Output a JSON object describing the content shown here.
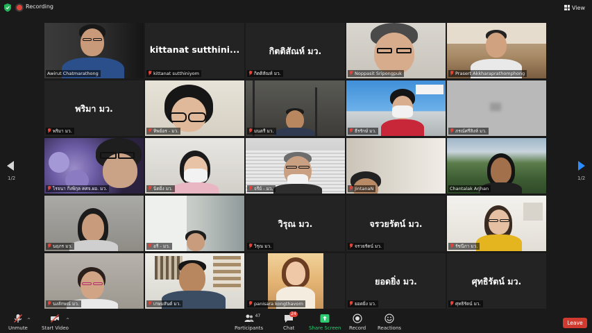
{
  "topbar": {
    "recording_label": "Recording",
    "view_label": "View"
  },
  "nav": {
    "left_page": "1/2",
    "right_page": "1/2"
  },
  "tiles": [
    {
      "name": "Awirut Chatmarathong",
      "big": "",
      "muted": false
    },
    {
      "name": "kittanat sutthiniyom",
      "big": "kittanat  sutthini...",
      "muted": true
    },
    {
      "name": "กิตติสัณห์ มว.",
      "big": "กิตติสัณห์ มว.",
      "muted": true
    },
    {
      "name": "Noppasit Sripongpuk",
      "big": "",
      "muted": true
    },
    {
      "name": "Prasert Akkharaprathomphong",
      "big": "",
      "muted": true
    },
    {
      "name": "พริมา มว.",
      "big": "พริมา มว.",
      "muted": true
    },
    {
      "name": "ทิพย์อร - มว.",
      "big": "",
      "muted": true
    },
    {
      "name": "มนตรี มว.",
      "big": "",
      "muted": true
    },
    {
      "name": "ธีรรักษ์ มว.",
      "big": "",
      "muted": true
    },
    {
      "name": "ภรณ์ศรีสิงห์ มว.",
      "big": "",
      "muted": true
    },
    {
      "name": "ไรจนา กิ่งพิกุล คศจ.ผอ. มว.",
      "big": "",
      "muted": true
    },
    {
      "name": "นิตยิ่ง มว.",
      "big": "",
      "muted": true
    },
    {
      "name": "จรีย์ - มว.",
      "big": "",
      "muted": true
    },
    {
      "name": "JintanaN",
      "big": "",
      "muted": true
    },
    {
      "name": "Chantalak Arjhan",
      "big": "",
      "muted": false
    },
    {
      "name": "นฤภร มว.",
      "big": "",
      "muted": true
    },
    {
      "name": "อรี - มว.",
      "big": "",
      "muted": true
    },
    {
      "name": "วิรุณ มว.",
      "big": "วิรุณ มว.",
      "muted": true
    },
    {
      "name": "จรวยรัตน์ มว.",
      "big": "จรวยรัตน์ มว.",
      "muted": true
    },
    {
      "name": "รัชนีภา มว.",
      "big": "",
      "muted": true
    },
    {
      "name": "นงลักษณ์ มว.",
      "big": "",
      "muted": true
    },
    {
      "name": "เกษมสันต์ มว.",
      "big": "",
      "muted": true
    },
    {
      "name": "panisara kongthavorn",
      "big": "",
      "muted": true
    },
    {
      "name": "ยอดยิ่ง มว.",
      "big": "ยอดยิ่ง มว.",
      "muted": true
    },
    {
      "name": "ศุทธิรัตน์ มว.",
      "big": "ศุทธิรัตน์ มว.",
      "muted": true
    }
  ],
  "toolbar": {
    "unmute": "Unmute",
    "start_video": "Start Video",
    "participants": "Participants",
    "participants_count": "47",
    "chat": "Chat",
    "chat_badge": "24",
    "share_screen": "Share Screen",
    "record": "Record",
    "reactions": "Reactions",
    "leave": "Leave"
  },
  "colors": {
    "accent": "#2d8cff",
    "active_speaker": "#d7e34a",
    "muted_red": "#e0453a",
    "share_green": "#2ecc71",
    "leave_red": "#d13b2f"
  }
}
